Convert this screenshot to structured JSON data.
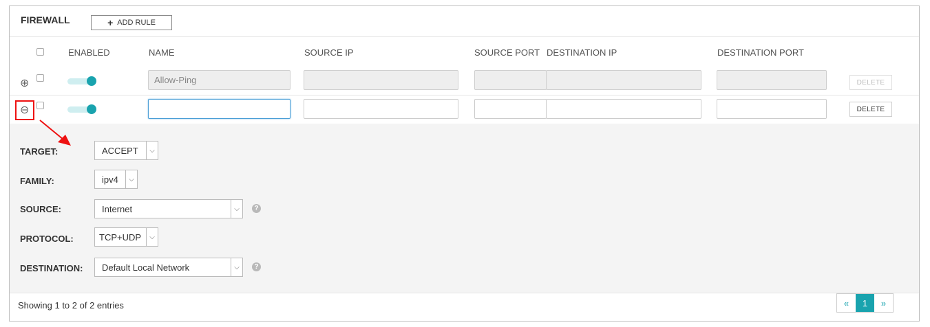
{
  "header": {
    "title": "FIREWALL",
    "add_rule_label": "ADD RULE"
  },
  "columns": {
    "enabled": "ENABLED",
    "name": "NAME",
    "source_ip": "SOURCE IP",
    "source_port": "SOURCE PORT",
    "destination_ip": "DESTINATION IP",
    "destination_port": "DESTINATION PORT"
  },
  "rows": [
    {
      "expand_icon": "plus-circle-icon",
      "enabled": true,
      "name": "Allow-Ping",
      "source_ip": "",
      "source_port": "",
      "destination_ip": "",
      "destination_port": "",
      "delete_label": "DELETE",
      "disabled": true
    },
    {
      "expand_icon": "minus-circle-icon",
      "enabled": true,
      "name": "",
      "source_ip": "",
      "source_port": "",
      "destination_ip": "",
      "destination_port": "",
      "delete_label": "DELETE",
      "disabled": false
    }
  ],
  "details": {
    "target": {
      "label": "TARGET:",
      "value": "ACCEPT"
    },
    "family": {
      "label": "FAMILY:",
      "value": "ipv4"
    },
    "source": {
      "label": "SOURCE:",
      "value": "Internet"
    },
    "protocol": {
      "label": "PROTOCOL:",
      "value": "TCP+UDP"
    },
    "destination": {
      "label": "DESTINATION:",
      "value": "Default Local Network"
    }
  },
  "footer": {
    "entries_text": "Showing 1 to 2 of 2 entries"
  },
  "pagination": {
    "prev": "«",
    "current": "1",
    "next": "»"
  },
  "colors": {
    "accent": "#19a3ae",
    "annotation": "#ee1111"
  }
}
